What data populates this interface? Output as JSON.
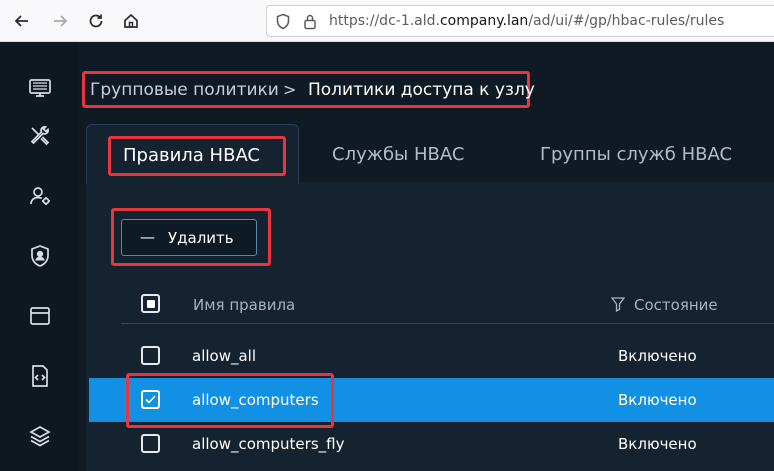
{
  "browser": {
    "url_prefix": "https://dc-1.ald.",
    "url_domain": "company.lan",
    "url_suffix": "/ad/ui/#/gp/hbac-rules/rules",
    "nav_icons": [
      "back-icon",
      "forward-icon",
      "reload-icon",
      "home-icon"
    ]
  },
  "sidebar": {
    "items": [
      {
        "icon": "monitor-icon"
      },
      {
        "icon": "tools-icon"
      },
      {
        "icon": "user-settings-icon"
      },
      {
        "icon": "shield-user-icon"
      },
      {
        "icon": "window-icon"
      },
      {
        "icon": "code-file-icon"
      },
      {
        "icon": "layers-icon"
      }
    ]
  },
  "breadcrumb": {
    "parent": "Групповые политики",
    "separator": ">",
    "current": "Политики доступа к узлу"
  },
  "tabs": [
    {
      "label": "Правила HBAC",
      "active": true
    },
    {
      "label": "Службы HBAC",
      "active": false
    },
    {
      "label": "Группы служб HBAC",
      "active": false
    }
  ],
  "toolbar": {
    "delete_label": "Удалить",
    "delete_icon": "—"
  },
  "table": {
    "columns": [
      "Имя правила",
      "Состояние"
    ],
    "rows": [
      {
        "name": "allow_all",
        "state": "Включено",
        "selected": false
      },
      {
        "name": "allow_computers",
        "state": "Включено",
        "selected": true
      },
      {
        "name": "allow_computers_fly",
        "state": "Включено",
        "selected": false
      }
    ]
  },
  "colors": {
    "accent": "#1290e3",
    "highlight": "#e8363f",
    "background": "#101a25"
  }
}
